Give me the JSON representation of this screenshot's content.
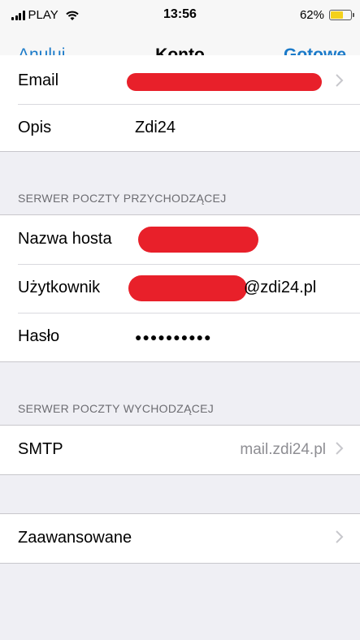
{
  "status_bar": {
    "carrier": "PLAY",
    "time": "13:56",
    "battery_percent": "62%",
    "battery_level": 0.62,
    "battery_color": "#f4d11c"
  },
  "nav": {
    "cancel_label": "Anuluj",
    "title": "Konto",
    "done_label": "Gotowe",
    "accent_color": "#1a7ac9"
  },
  "account": {
    "email_label": "Email",
    "description_label": "Opis",
    "description_value": "Zdi24"
  },
  "incoming": {
    "header": "SERWER POCZTY PRZYCHODZĄCEJ",
    "host_label": "Nazwa hosta",
    "user_label": "Użytkownik",
    "user_value_suffix": "@zdi24.pl",
    "password_label": "Hasło",
    "password_value": "●●●●●●●●●●"
  },
  "outgoing": {
    "header": "SERWER POCZTY WYCHODZĄCEJ",
    "smtp_label": "SMTP",
    "smtp_value": "mail.zdi24.pl"
  },
  "advanced": {
    "label": "Zaawansowane"
  },
  "redaction_color": "#e8202a"
}
